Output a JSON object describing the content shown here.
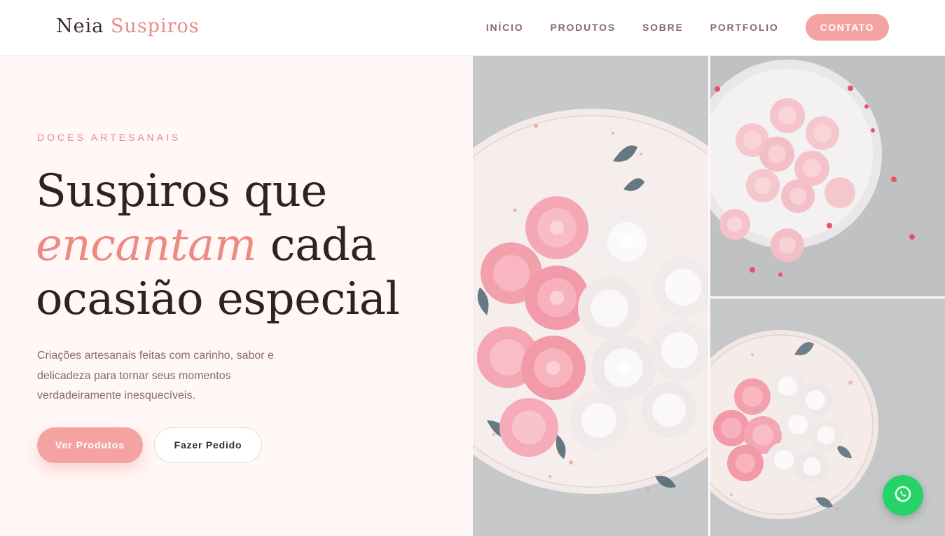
{
  "brand": {
    "name_first": "Neia",
    "name_second": "Suspiros"
  },
  "nav": {
    "items": [
      {
        "label": "INÍCIO"
      },
      {
        "label": "PRODUTOS"
      },
      {
        "label": "SOBRE"
      },
      {
        "label": "PORTFOLIO"
      }
    ],
    "cta_label": "CONTATO"
  },
  "hero": {
    "eyebrow": "DOCES ARTESANAIS",
    "headline_line1": "Suspiros que",
    "headline_emphasis": "encantam",
    "headline_line2_rest": " cada",
    "headline_line3": "ocasião especial",
    "lead": "Criações artesanais feitas com carinho, sabor e delicadeza para tornar seus momentos verdadeiramente inesquecíveis.",
    "primary_button": "Ver Produtos",
    "secondary_button": "Fazer Pedido"
  },
  "colors": {
    "accent": "#f4a3a0",
    "accent_text": "#e98b86",
    "heading": "#2e2323",
    "body_text": "#8a6a6a",
    "background": "#fff8f6",
    "whatsapp": "#25d366"
  },
  "icons": {
    "floating_button": "whatsapp-icon"
  }
}
